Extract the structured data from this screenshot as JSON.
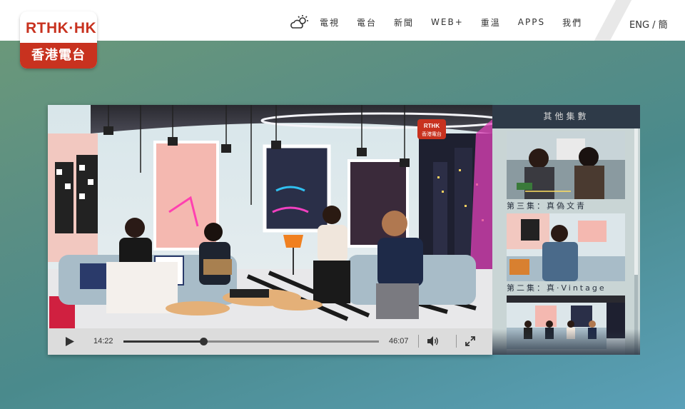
{
  "logo": {
    "top": "RTHK·HK",
    "bottom": "香港電台"
  },
  "nav": {
    "weather_icon": "weather-partly-cloudy-icon",
    "items": [
      {
        "label": "電視"
      },
      {
        "label": "電台"
      },
      {
        "label": "新聞"
      },
      {
        "label": "WEB+"
      },
      {
        "label": "重溫"
      },
      {
        "label": "APPS"
      },
      {
        "label": "我們"
      }
    ]
  },
  "language": {
    "label": "ENG / 簡"
  },
  "player": {
    "current_time": "14:22",
    "duration": "46:07",
    "progress_fraction": 0.312,
    "watermark": "RTHK 香港電台"
  },
  "episodes": {
    "title": "其他集數",
    "items": [
      {
        "label": "第三集：真偽文青"
      },
      {
        "label": "第二集：真·Vintage"
      },
      {
        "label": ""
      }
    ]
  },
  "colors": {
    "brand_red": "#c8321f",
    "panel_dark": "#2e3a48",
    "controls_bg": "#dcdcdc"
  }
}
